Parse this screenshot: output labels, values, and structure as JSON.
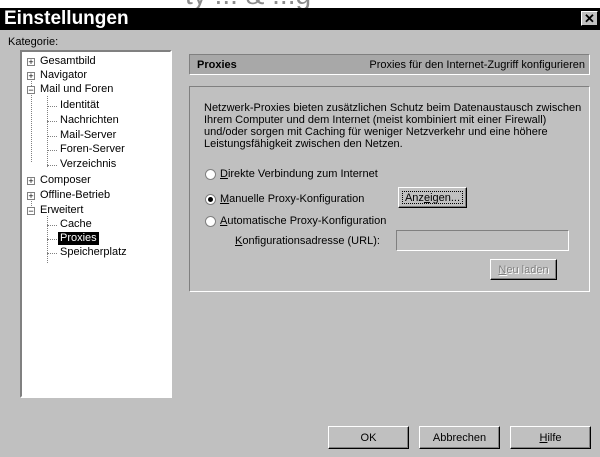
{
  "background_text": "ty ... & ...g",
  "window": {
    "title": "Einstellungen",
    "close_glyph": "✕"
  },
  "kategorie_label": "Kategorie:",
  "tree": {
    "gesamtbild": "Gesamtbild",
    "navigator": "Navigator",
    "mail_foren": "Mail und Foren",
    "identitaet": "Identität",
    "nachrichten": "Nachrichten",
    "mail_server": "Mail-Server",
    "foren_server": "Foren-Server",
    "verzeichnis": "Verzeichnis",
    "composer": "Composer",
    "offline": "Offline-Betrieb",
    "erweitert": "Erweitert",
    "cache": "Cache",
    "proxies": "Proxies",
    "speicherplatz": "Speicherplatz"
  },
  "header": {
    "title": "Proxies",
    "description": "Proxies für den Internet-Zugriff konfigurieren"
  },
  "description": "Netzwerk-Proxies bieten zusätzlichen Schutz beim Datenaustausch zwischen Ihrem Computer und dem Internet (meist kombiniert mit einer Firewall) und/oder sorgen mit Caching für weniger Netzverkehr und eine höhere Leistungsfähigkeit zwischen den Netzen.",
  "options": {
    "direct": {
      "key": "D",
      "rest": "irekte Verbindung zum Internet"
    },
    "manual": {
      "key": "M",
      "rest": "anuelle Proxy-Konfiguration"
    },
    "auto": {
      "key": "A",
      "rest": "utomatische Proxy-Konfiguration"
    },
    "selected": "manual"
  },
  "view_button": {
    "pre": "Anz",
    "key": "e",
    "post": "igen..."
  },
  "url": {
    "label_key": "K",
    "label_rest": "onfigurationsadresse (URL):",
    "value": ""
  },
  "reload_button": {
    "key": "N",
    "rest": "eu laden"
  },
  "buttons": {
    "ok": "OK",
    "cancel": "Abbrechen",
    "help_key": "H",
    "help_rest": "ilfe"
  }
}
